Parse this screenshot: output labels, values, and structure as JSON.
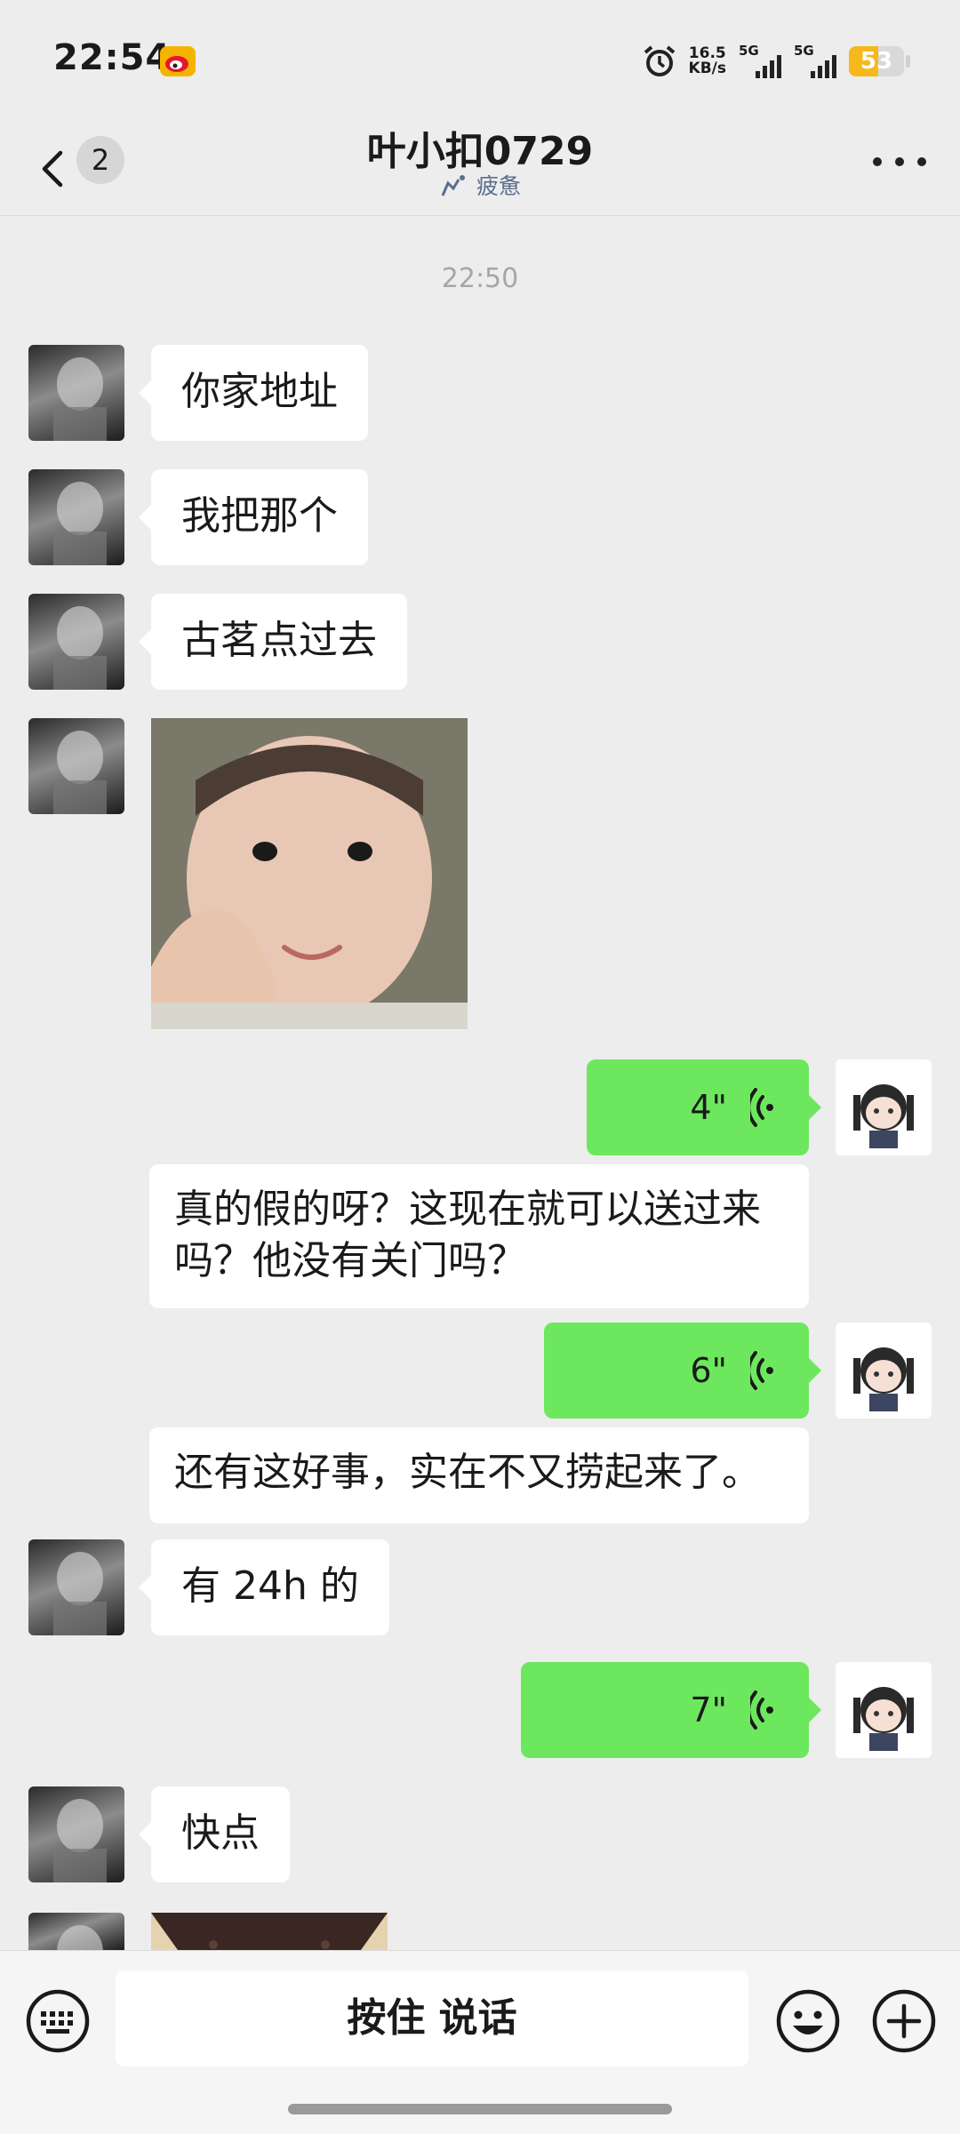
{
  "status_bar": {
    "time": "22:54",
    "net_speed_value": "16.5",
    "net_speed_unit": "KB/s",
    "sim1_label": "5G",
    "sim2_label": "5G",
    "battery": "53",
    "battery_color": "#f6b81a"
  },
  "header": {
    "unread_count": "2",
    "title": "叶小扣0729",
    "status_text": "疲惫"
  },
  "chat": {
    "timestamp": "22:50",
    "messages": [
      {
        "side": "left",
        "type": "text",
        "text": "你家地址"
      },
      {
        "side": "left",
        "type": "text",
        "text": "我把那个"
      },
      {
        "side": "left",
        "type": "text",
        "text": "古茗点过去"
      },
      {
        "side": "left",
        "type": "image",
        "icon": "baby-face-sticker"
      },
      {
        "side": "right",
        "type": "voice",
        "duration": "4\""
      },
      {
        "side": "right",
        "type": "voice_transcript",
        "text": "真的假的呀？这现在就可以送过来吗？他没有关门吗？"
      },
      {
        "side": "right",
        "type": "voice",
        "duration": "6\""
      },
      {
        "side": "right",
        "type": "voice_transcript",
        "text": "还有这好事，实在不又捞起来了。"
      },
      {
        "side": "left",
        "type": "text",
        "text": "有 24h 的"
      },
      {
        "side": "right",
        "type": "voice",
        "duration": "7\""
      },
      {
        "side": "left",
        "type": "text",
        "text": "快点"
      },
      {
        "side": "left",
        "type": "image",
        "icon": "cat-sticker"
      }
    ]
  },
  "input_bar": {
    "hold_to_talk": "按住 说话"
  },
  "colors": {
    "background": "#ededed",
    "sent_bubble": "#6de85e",
    "received_bubble": "#ffffff"
  }
}
